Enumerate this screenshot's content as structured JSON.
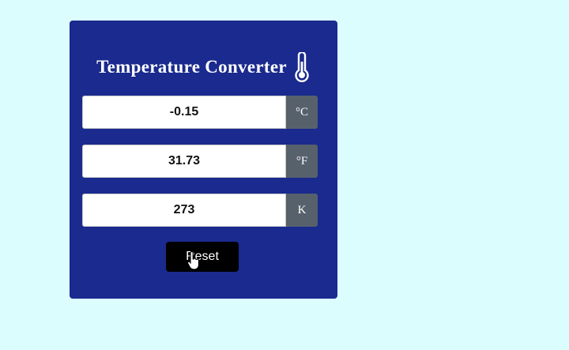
{
  "converter": {
    "title": "Temperature Converter",
    "title_icon": "thermometer-icon",
    "fields": [
      {
        "value": "-0.15",
        "unit": "°C"
      },
      {
        "value": "31.73",
        "unit": "°F"
      },
      {
        "value": "273",
        "unit": "K"
      }
    ],
    "reset_label": "Reset"
  },
  "colors": {
    "page_background": "#dcfdfe",
    "card_background": "#1a2a8e",
    "unit_background": "#56616c",
    "button_background": "#000000"
  }
}
